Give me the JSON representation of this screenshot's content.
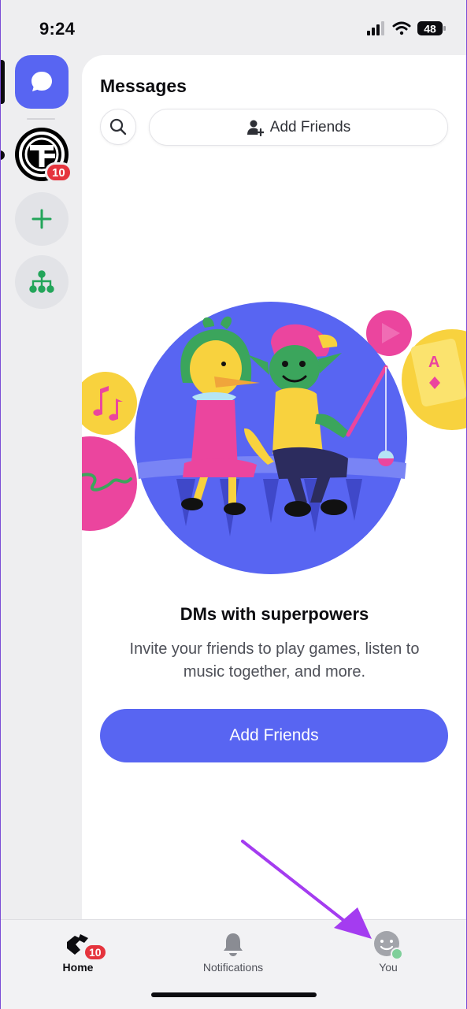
{
  "status_bar": {
    "time": "9:24",
    "battery": "48"
  },
  "server_rail": {
    "server_badge": "10"
  },
  "messages": {
    "title": "Messages",
    "add_friends_label": "Add Friends"
  },
  "empty_state": {
    "title": "DMs with superpowers",
    "description": "Invite your friends to play games, listen to music together, and more.",
    "button_label": "Add Friends"
  },
  "tab_bar": {
    "tabs": [
      {
        "label": "Home",
        "badge": "10",
        "icon": "home-icon",
        "active": true
      },
      {
        "label": "Notifications",
        "icon": "bell-icon",
        "active": false
      },
      {
        "label": "You",
        "icon": "avatar-icon",
        "active": false
      }
    ]
  },
  "colors": {
    "blurple": "#5865f2",
    "badge_red": "#e5343d",
    "online_green": "#3ba55c",
    "annotation_purple": "#a43cf0"
  }
}
